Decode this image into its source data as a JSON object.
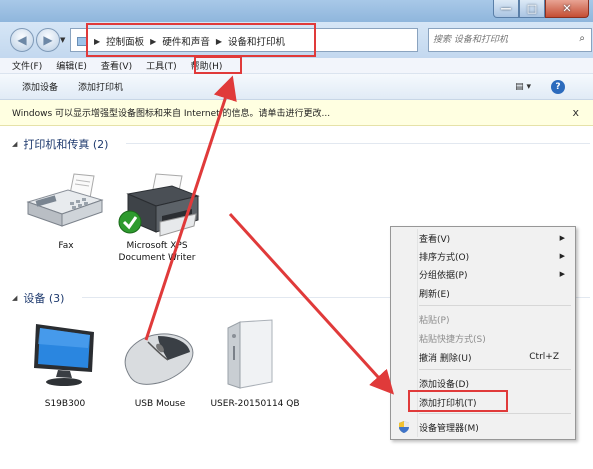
{
  "window": {
    "controls": {
      "minimize": "—",
      "maximize": "□",
      "close": "✕"
    }
  },
  "nav": {
    "back_icon": "back-arrow-icon",
    "forward_icon": "forward-arrow-icon",
    "breadcrumbs": [
      "控制面板",
      "硬件和声音",
      "设备和打印机"
    ],
    "search_placeholder": "搜索 设备和打印机"
  },
  "menubar": [
    "文件(F)",
    "编辑(E)",
    "查看(V)",
    "工具(T)",
    "帮助(H)"
  ],
  "toolbar": {
    "add_device": "添加设备",
    "add_printer": "添加打印机"
  },
  "infobar": {
    "text": "Windows 可以显示增强型设备图标和来自 Internet 的信息。请单击进行更改...",
    "close": "x"
  },
  "groups": [
    {
      "title": "打印机和传真 (2)",
      "items": [
        {
          "label": "Fax"
        },
        {
          "label": "Microsoft XPS Document Writer"
        }
      ]
    },
    {
      "title": "设备 (3)",
      "items": [
        {
          "label": "S19B300"
        },
        {
          "label": "USB Mouse"
        },
        {
          "label": "USER-20150114 QB"
        }
      ]
    }
  ],
  "context_menu": {
    "items": [
      {
        "label": "查看(V)",
        "submenu": true
      },
      {
        "label": "排序方式(O)",
        "submenu": true
      },
      {
        "label": "分组依据(P)",
        "submenu": true
      },
      {
        "label": "刷新(E)"
      },
      {
        "label": "粘贴(P)",
        "disabled": true
      },
      {
        "label": "粘贴快捷方式(S)",
        "disabled": true
      },
      {
        "label": "撤消 删除(U)",
        "shortcut": "Ctrl+Z"
      },
      {
        "label": "添加设备(D)"
      },
      {
        "label": "添加打印机(T)"
      },
      {
        "label": "设备管理器(M)"
      }
    ]
  },
  "colors": {
    "annotation": "#e03a3a",
    "link_blue": "#1e3a6e"
  }
}
